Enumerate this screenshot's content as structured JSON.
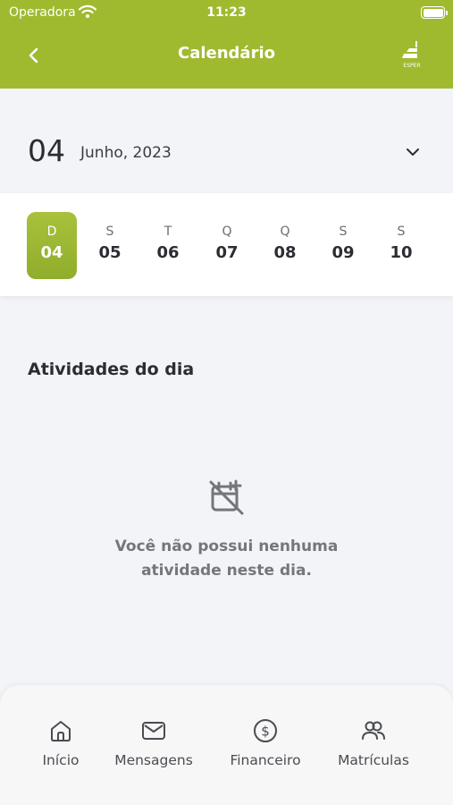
{
  "status": {
    "carrier": "Operadora",
    "time": "11:23"
  },
  "header": {
    "title": "Calendário",
    "back_icon": "chevron-left-icon",
    "logo_text": "ESPER"
  },
  "month_selector": {
    "day": "04",
    "month_year": "Junho, 2023",
    "dropdown_icon": "chevron-down-icon"
  },
  "week": [
    {
      "letter": "D",
      "number": "04",
      "selected": true
    },
    {
      "letter": "S",
      "number": "05",
      "selected": false
    },
    {
      "letter": "T",
      "number": "06",
      "selected": false
    },
    {
      "letter": "Q",
      "number": "07",
      "selected": false
    },
    {
      "letter": "Q",
      "number": "08",
      "selected": false
    },
    {
      "letter": "S",
      "number": "09",
      "selected": false
    },
    {
      "letter": "S",
      "number": "10",
      "selected": false
    }
  ],
  "activities": {
    "title": "Atividades do dia",
    "empty_icon": "calendar-off-icon",
    "empty_line1": "Você não possui nenhuma",
    "empty_line2": "atividade neste dia."
  },
  "tabs": [
    {
      "label": "Início",
      "icon": "home-icon"
    },
    {
      "label": "Mensagens",
      "icon": "mail-icon"
    },
    {
      "label": "Financeiro",
      "icon": "dollar-circle-icon"
    },
    {
      "label": "Matrículas",
      "icon": "users-icon"
    }
  ],
  "colors": {
    "accent": "#9fba2f",
    "background": "#f3f4f8",
    "text": "#2b2d33",
    "muted": "#74767c"
  }
}
